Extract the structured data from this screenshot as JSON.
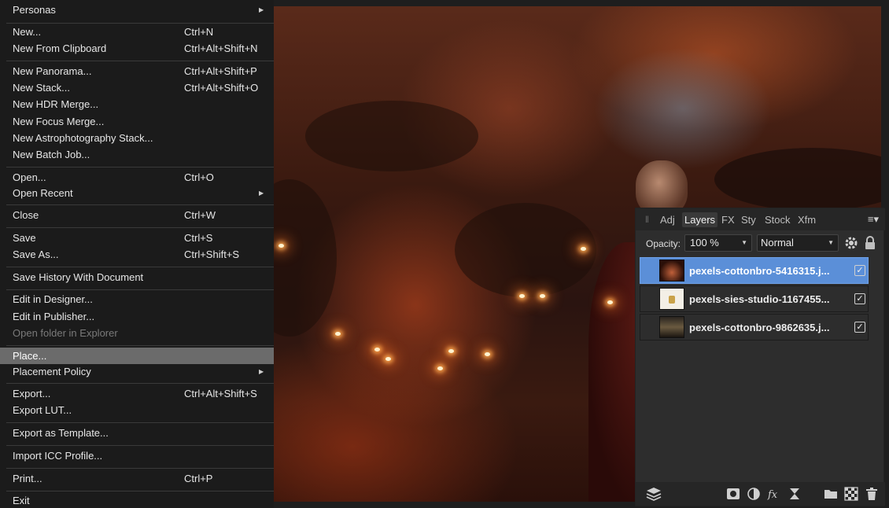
{
  "file_menu": {
    "items": [
      {
        "label": "Personas",
        "shortcut": "",
        "submenu": true
      },
      {
        "label": "New...",
        "shortcut": "Ctrl+N"
      },
      {
        "label": "New From Clipboard",
        "shortcut": "Ctrl+Alt+Shift+N"
      },
      {
        "label": "New Panorama...",
        "shortcut": "Ctrl+Alt+Shift+P"
      },
      {
        "label": "New Stack...",
        "shortcut": "Ctrl+Alt+Shift+O"
      },
      {
        "label": "New HDR Merge...",
        "shortcut": ""
      },
      {
        "label": "New Focus Merge...",
        "shortcut": ""
      },
      {
        "label": "New Astrophotography Stack...",
        "shortcut": ""
      },
      {
        "label": "New Batch Job...",
        "shortcut": ""
      },
      {
        "label": "Open...",
        "shortcut": "Ctrl+O"
      },
      {
        "label": "Open Recent",
        "shortcut": "",
        "submenu": true
      },
      {
        "label": "Close",
        "shortcut": "Ctrl+W"
      },
      {
        "label": "Save",
        "shortcut": "Ctrl+S"
      },
      {
        "label": "Save As...",
        "shortcut": "Ctrl+Shift+S"
      },
      {
        "label": "Save History With Document",
        "shortcut": ""
      },
      {
        "label": "Edit in Designer...",
        "shortcut": ""
      },
      {
        "label": "Edit in Publisher...",
        "shortcut": ""
      },
      {
        "label": "Open folder in Explorer",
        "shortcut": "",
        "disabled": true
      },
      {
        "label": "Place...",
        "shortcut": "",
        "highlighted": true
      },
      {
        "label": "Placement Policy",
        "shortcut": "",
        "submenu": true
      },
      {
        "label": "Export...",
        "shortcut": "Ctrl+Alt+Shift+S"
      },
      {
        "label": "Export LUT...",
        "shortcut": ""
      },
      {
        "label": "Export as Template...",
        "shortcut": ""
      },
      {
        "label": "Import ICC Profile...",
        "shortcut": ""
      },
      {
        "label": "Print...",
        "shortcut": "Ctrl+P"
      },
      {
        "label": "Exit",
        "shortcut": ""
      }
    ]
  },
  "layers_panel": {
    "tabs": [
      "Adj",
      "Layers",
      "FX",
      "Sty",
      "Stock",
      "Xfm"
    ],
    "active_tab": "Layers",
    "opacity_label": "Opacity:",
    "opacity_value": "100 %",
    "blend_mode": "Normal",
    "layers": [
      {
        "name": "pexels-cottonbro-5416315.j...",
        "selected": true,
        "visible": true
      },
      {
        "name": "pexels-sies-studio-1167455...",
        "selected": false,
        "visible": true
      },
      {
        "name": "pexels-cottonbro-9862635.j...",
        "selected": false,
        "visible": true
      }
    ],
    "bottom_icons": [
      "layers-stack-icon",
      "mask-icon",
      "adjustment-icon",
      "fx-icon",
      "hourglass-icon",
      "folder-icon",
      "checkerboard-icon",
      "trash-icon"
    ]
  },
  "colors": {
    "menu_bg": "#1b1b1b",
    "highlight": "#6b6b6b",
    "selected_layer": "#5b8fd8",
    "panel_bg": "#2d2d2d"
  }
}
